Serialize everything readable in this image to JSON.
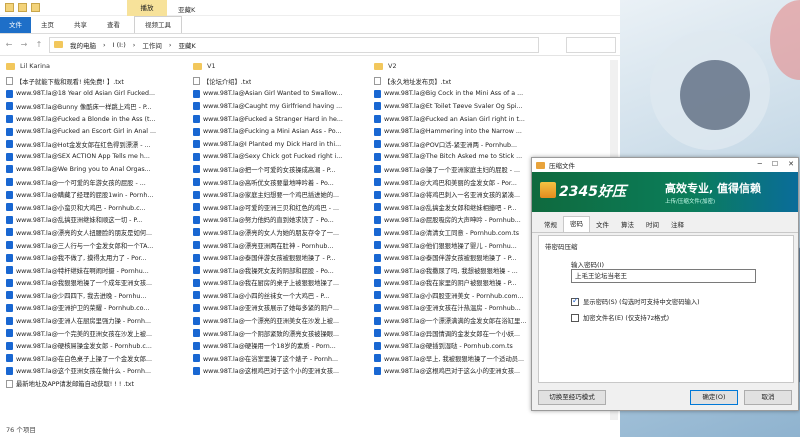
{
  "titlebar": {
    "manage_tab": "播放",
    "title": "亚藏K"
  },
  "ribbon": {
    "tabs": [
      "文件",
      "主页",
      "共享",
      "查看",
      "视频工具"
    ]
  },
  "address": {
    "path": [
      "我的电脑",
      "I (I:)",
      "工作间",
      "亚藏K"
    ]
  },
  "folders": [
    "Lil Karina",
    "V1",
    "V2"
  ],
  "columns": [
    {
      "files": [
        {
          "icon": "txt",
          "name": "【本子就能下载和观看! 纯免费! 】.txt"
        },
        {
          "icon": "url",
          "name": "www.98T.la@18 Year old Asian Girl Fucked..."
        },
        {
          "icon": "url",
          "name": "www.98T.la@Bunny 像酷床一样跳上鸡巴 - P..."
        },
        {
          "icon": "url",
          "name": "www.98T.la@Fucked a Blonde in the Ass (t..."
        },
        {
          "icon": "url",
          "name": "www.98T.la@Fucked an Escort Girl in Anal ..."
        },
        {
          "icon": "url",
          "name": "www.98T.la@Hot金发女郎在红色得到漂漂 - ..."
        },
        {
          "icon": "url",
          "name": "www.98T.la@SEX ACTION App Tells me h..."
        },
        {
          "icon": "url",
          "name": "www.98T.la@We Bring you to Anal Orgas..."
        },
        {
          "icon": "url",
          "name": "www.98T.la@一个可爱的年游女孩的屁股 - ..."
        },
        {
          "icon": "url",
          "name": "www.98T.la@瞒藏了经理的屁股1win - Pornh..."
        },
        {
          "icon": "url",
          "name": "www.98T.la@小蛮贝和大鸡巴 - Pornhub.c..."
        },
        {
          "icon": "url",
          "name": "www.98T.la@乱搞亚洲继妹和顺这一切 - P..."
        },
        {
          "icon": "url",
          "name": "www.98T.la@漂亮的女人扭腰脸的朋友是如何..."
        },
        {
          "icon": "url",
          "name": "www.98T.la@三人行与一个金发女郎和一个TA..."
        },
        {
          "icon": "url",
          "name": "www.98T.la@我不做了, 摸得太用力了 - Por..."
        },
        {
          "icon": "url",
          "name": "www.98T.la@特杆继妹在啊闹时摄 - Pornhu..."
        },
        {
          "icon": "url",
          "name": "www.98T.la@我狠狠地操了一个成年亚洲女孩..."
        },
        {
          "icon": "url",
          "name": "www.98T.la@少四四下, 我去进晚 - Pornhu..."
        },
        {
          "icon": "url",
          "name": "www.98T.la@亚洲护卫的荣耀 - Pornhub.co..."
        },
        {
          "icon": "url",
          "name": "www.98T.la@亚洲人在厨房里强力操 - Pornh..."
        },
        {
          "icon": "url",
          "name": "www.98T.la@一个完美的亚洲女孩在沙发上被..."
        },
        {
          "icon": "url",
          "name": "www.98T.la@硬核屌操金发女郎 - Pornhub.c..."
        },
        {
          "icon": "url",
          "name": "www.98T.la@在白色桌子上操了一个金发女郎..."
        },
        {
          "icon": "url",
          "name": "www.98T.la@这个亚洲女孩在做什么 - Pornh..."
        },
        {
          "icon": "txt",
          "name": "最新地址及APP请发邮箱自动获取! ! ! .txt"
        }
      ]
    },
    {
      "files": [
        {
          "icon": "txt",
          "name": "【论坛介绍】.txt"
        },
        {
          "icon": "url",
          "name": "www.98T.la@Asian Girl Wanted to Swallow..."
        },
        {
          "icon": "url",
          "name": "www.98T.la@Caught my Girlfriend having ..."
        },
        {
          "icon": "url",
          "name": "www.98T.la@Fucked a Stranger Hard in he..."
        },
        {
          "icon": "url",
          "name": "www.98T.la@Fucking a Mini Asian Ass - Po..."
        },
        {
          "icon": "url",
          "name": "www.98T.la@I Planted my Dick Hard in thi..."
        },
        {
          "icon": "url",
          "name": "www.98T.la@Sexy Chick got Fucked right i..."
        },
        {
          "icon": "url",
          "name": "www.98T.la@把一个可爱的女孩操成高潮 - P..."
        },
        {
          "icon": "url",
          "name": "www.98T.la@高听优女孩要量地呻吟着 - Po..."
        },
        {
          "icon": "url",
          "name": "www.98T.la@家庭主妇想要一个鸡巴插进她的..."
        },
        {
          "icon": "url",
          "name": "www.98T.la@可爱的亚洲三贝和红色的鸡巴 - ..."
        },
        {
          "icon": "url",
          "name": "www.98T.la@努力他妈的直到她求饶了 - Po..."
        },
        {
          "icon": "url",
          "name": "www.98T.la@漂亮的女人为她的朋友存令了一..."
        },
        {
          "icon": "url",
          "name": "www.98T.la@漂亮亚洲两在肚神 - Pornhub..."
        },
        {
          "icon": "url",
          "name": "www.98T.la@泰国伴游女孩被狠狠地操了 - P..."
        },
        {
          "icon": "url",
          "name": "www.98T.la@我操死女友的阴部和屁股 - Po..."
        },
        {
          "icon": "url",
          "name": "www.98T.la@我在厨房的桌子上被狠狠地操了..."
        },
        {
          "icon": "url",
          "name": "www.98T.la@小四的丝袜女一个大鸡巴 - P..."
        },
        {
          "icon": "url",
          "name": "www.98T.la@亚洲女孩展示了她每多紧的阴户..."
        },
        {
          "icon": "url",
          "name": "www.98T.la@一个漂亮的亚洲美女在沙发上被..."
        },
        {
          "icon": "url",
          "name": "www.98T.la@一个阴部紧致的漂亮女孩被操眼..."
        },
        {
          "icon": "url",
          "name": "www.98T.la@硬操用一个18岁的素质 - Porn..."
        },
        {
          "icon": "url",
          "name": "www.98T.la@在浴室里操了这个婊子 - Pornh..."
        },
        {
          "icon": "url",
          "name": "www.98T.la@这根鸡巴对于这个小的亚洲女孩..."
        }
      ]
    },
    {
      "files": [
        {
          "icon": "txt",
          "name": "【永久地址发布页】.txt"
        },
        {
          "icon": "url",
          "name": "www.98T.la@Big Cock in the Mini Ass of a ..."
        },
        {
          "icon": "url",
          "name": "www.98T.la@Et Toilet Tøeve Svaler Og Spi..."
        },
        {
          "icon": "url",
          "name": "www.98T.la@Fucked an Asian Girl right in t..."
        },
        {
          "icon": "url",
          "name": "www.98T.la@Hammering into the Narrow ..."
        },
        {
          "icon": "url",
          "name": "www.98T.la@POV口活-紧亚洲两 - Pornhub..."
        },
        {
          "icon": "url",
          "name": "www.98T.la@The Bitch Asked me to Stick ..."
        },
        {
          "icon": "url",
          "name": "www.98T.la@操了一个亚洲家庭主妇的屁股 - ..."
        },
        {
          "icon": "url",
          "name": "www.98T.la@大鸡巴和美丽的金发女郎 - Por..."
        },
        {
          "icon": "url",
          "name": "www.98T.la@将鸡巴刺入一名亚洲女孩的紧凑..."
        },
        {
          "icon": "url",
          "name": "www.98T.la@乱搞金发女郎和继妹相撞吧 - P..."
        },
        {
          "icon": "url",
          "name": "www.98T.la@屁股吸房的大声呻吟 - Pornhub..."
        },
        {
          "icon": "url",
          "name": "www.98T.la@清清女工同意 - Pornhub.com.ts"
        },
        {
          "icon": "url",
          "name": "www.98T.la@他们狠狠地操了婴儿 - Pornhu..."
        },
        {
          "icon": "url",
          "name": "www.98T.la@泰国伴游女孩被狠狠地操了 - P..."
        },
        {
          "icon": "url",
          "name": "www.98T.la@我撒尿了吗, 我想被狠狠地操 - ..."
        },
        {
          "icon": "url",
          "name": "www.98T.la@我在家里的阴户被狠狠地操 - P..."
        },
        {
          "icon": "url",
          "name": "www.98T.la@小四股亚洲美女 - Pornhub.com..."
        },
        {
          "icon": "url",
          "name": "www.98T.la@亚洲女孩在汁热温房 - Pornhub..."
        },
        {
          "icon": "url",
          "name": "www.98T.la@一个漂漂满满的金发女郎在浴缸里..."
        },
        {
          "icon": "url",
          "name": "www.98T.la@异国情调的金发女郎在一个小妖..."
        },
        {
          "icon": "url",
          "name": "www.98T.la@硬插到湿哒 - Pornhub.com.ts"
        },
        {
          "icon": "url",
          "name": "www.98T.la@早上, 我被狠狠地操了一个适动员..."
        },
        {
          "icon": "url",
          "name": "www.98T.la@这根鸡巴对于这么小的亚洲女孩..."
        }
      ]
    }
  ],
  "status": {
    "count": "76 个项目"
  },
  "dialog": {
    "title": "压缩文件",
    "logo": "2345好压",
    "slogan": "高效专业, 值得信赖",
    "sub": "上传/压缩文件(加密)",
    "tabs": [
      "常规",
      "密码",
      "文件",
      "算法",
      "时间",
      "注释"
    ],
    "active_tab": "密码",
    "group_label": "带密码压缩",
    "pwd_label": "输入密码(I)",
    "pwd_value": "上毛王论坛当老王",
    "show_pwd": "显示密码(S)   (勾选时可支持中文密码输入)",
    "show_pwd_checked": true,
    "encrypt_names": "加密文件名(E)   (仅支持7z格式)",
    "encrypt_names_checked": false,
    "btn_simple": "切换至经巧模式",
    "btn_ok": "确定(O)",
    "btn_cancel": "取消"
  }
}
